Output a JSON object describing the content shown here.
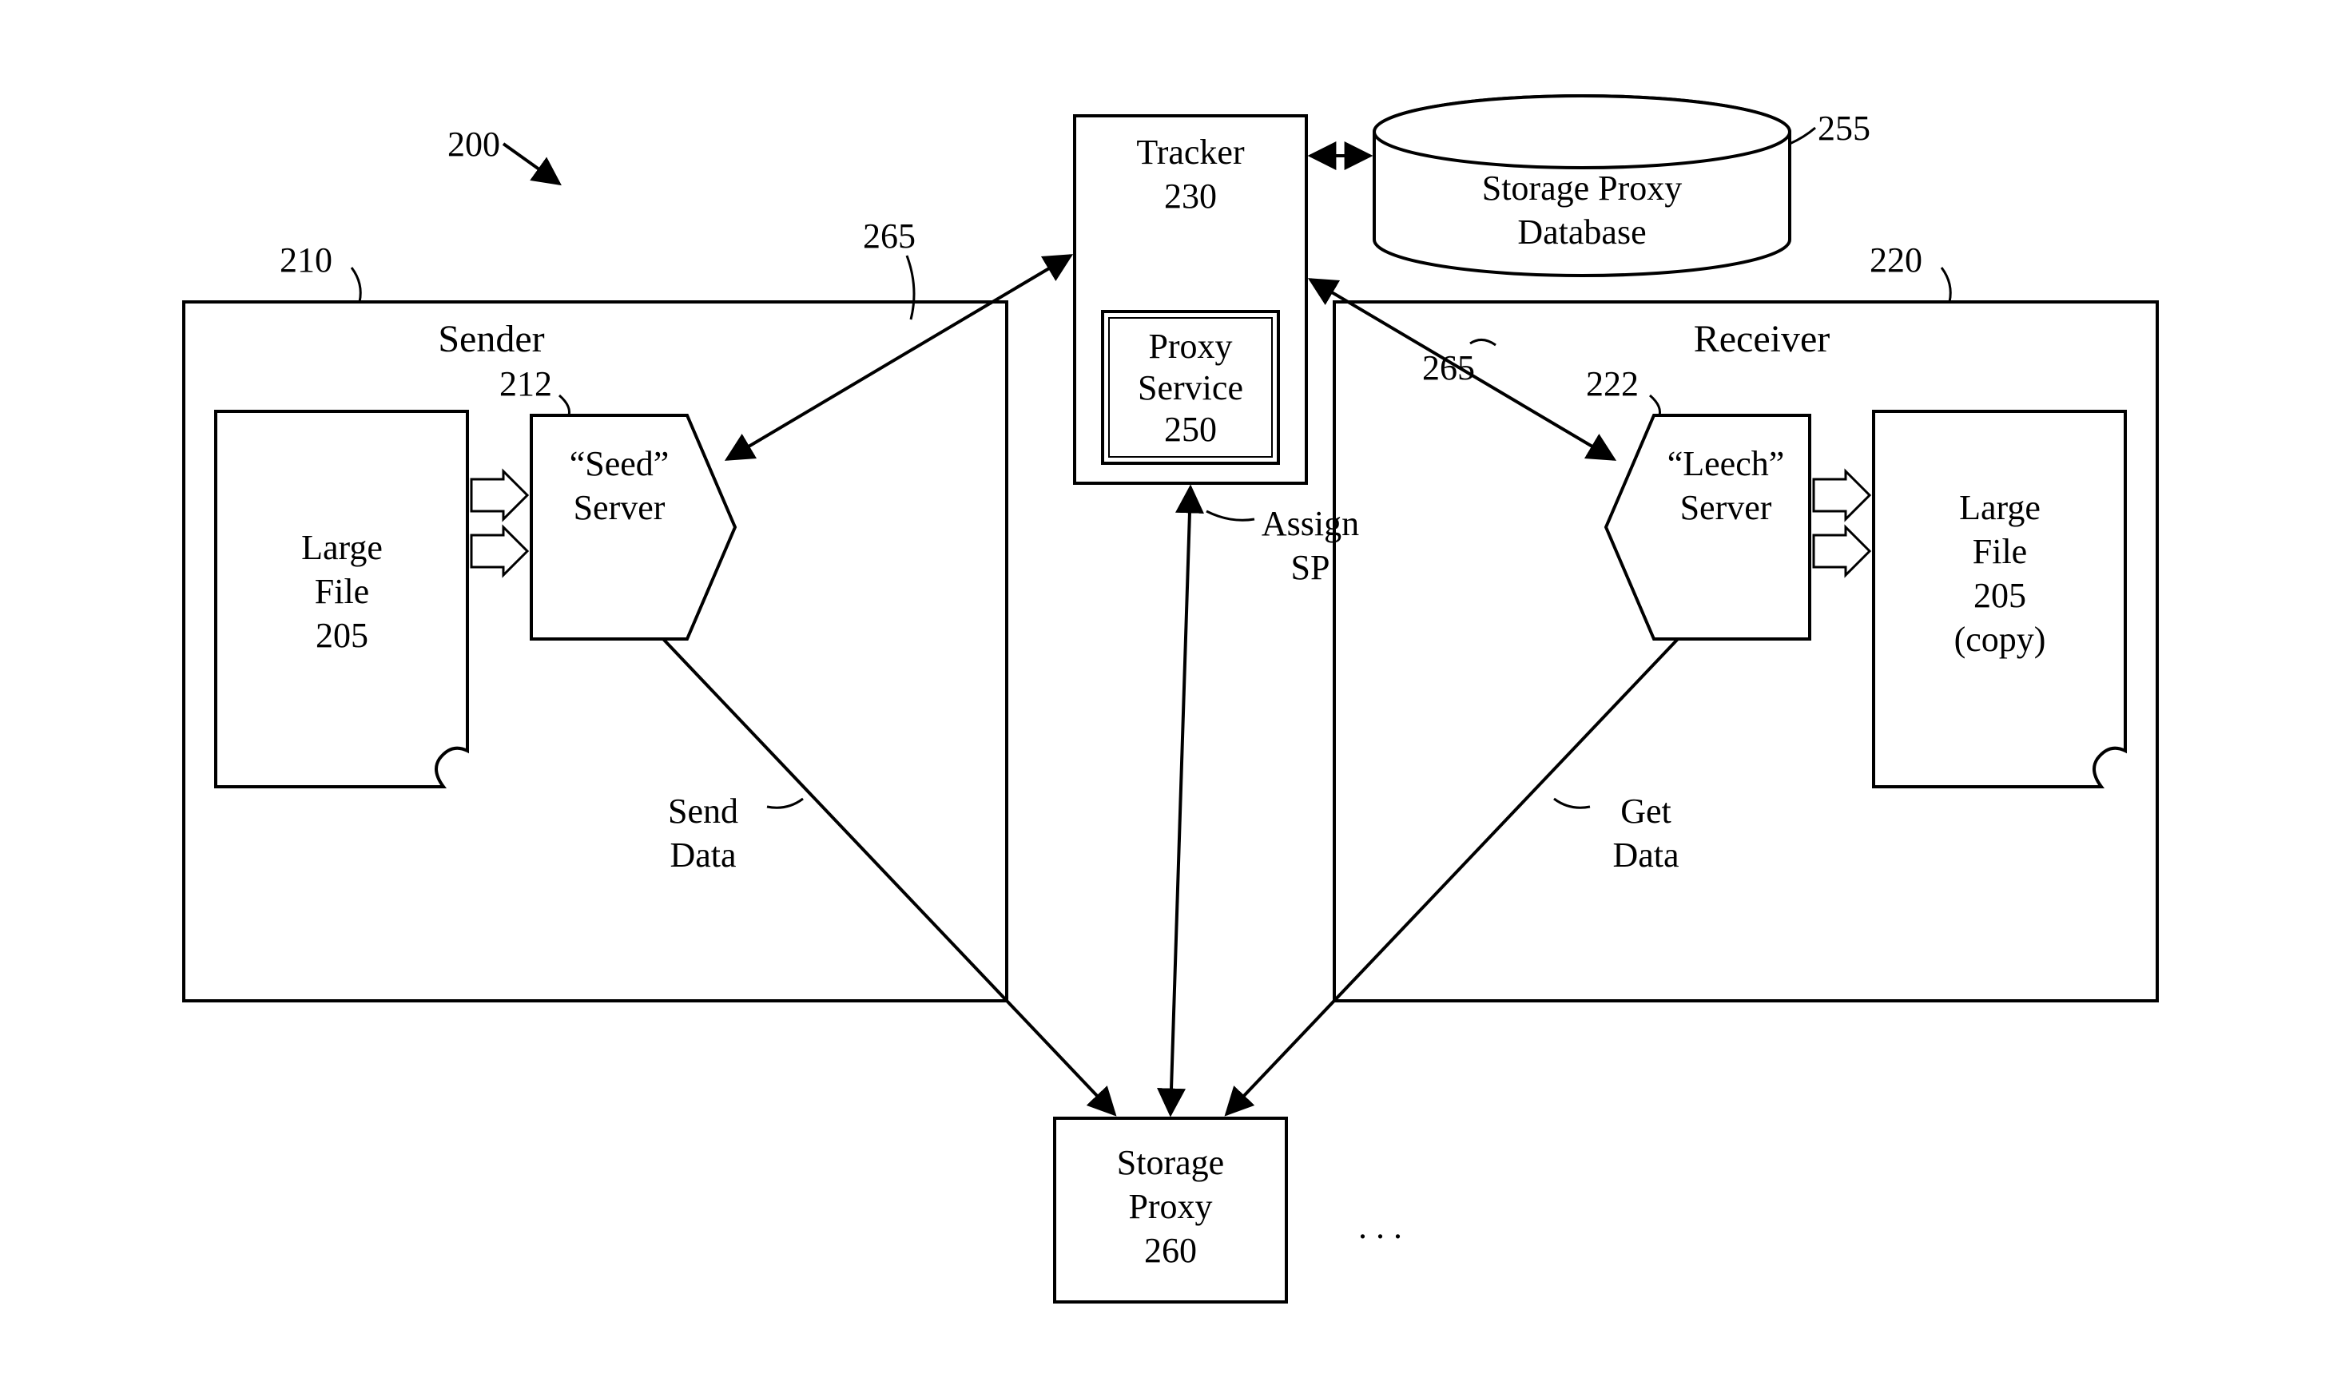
{
  "refs": {
    "overall": "200",
    "sender_box": "210",
    "seed_server": "212",
    "receiver_box": "220",
    "leech_server": "222",
    "tracker": "230",
    "proxy_service": "250",
    "storage_proxy_db": "255",
    "storage_proxy": "260",
    "tracker_link_left": "265",
    "tracker_link_right": "265"
  },
  "labels": {
    "sender_title": "Sender",
    "receiver_title": "Receiver",
    "tracker_l1": "Tracker",
    "tracker_l2": "230",
    "proxy_service_l1": "Proxy",
    "proxy_service_l2": "Service",
    "proxy_service_l3": "250",
    "storage_proxy_db_l1": "Storage Proxy",
    "storage_proxy_db_l2": "Database",
    "seed_l1": "“Seed”",
    "seed_l2": "Server",
    "leech_l1": "“Leech”",
    "leech_l2": "Server",
    "large_file_l1": "Large",
    "large_file_l2": "File",
    "large_file_l3": "205",
    "large_file_copy_l1": "Large",
    "large_file_copy_l2": "File",
    "large_file_copy_l3": "205",
    "large_file_copy_l4": "(copy)",
    "send_data_l1": "Send",
    "send_data_l2": "Data",
    "get_data_l1": "Get",
    "get_data_l2": "Data",
    "assign_sp_l1": "Assign",
    "assign_sp_l2": "SP",
    "storage_proxy_l1": "Storage",
    "storage_proxy_l2": "Proxy",
    "storage_proxy_l3": "260",
    "ellipsis": ". . ."
  }
}
